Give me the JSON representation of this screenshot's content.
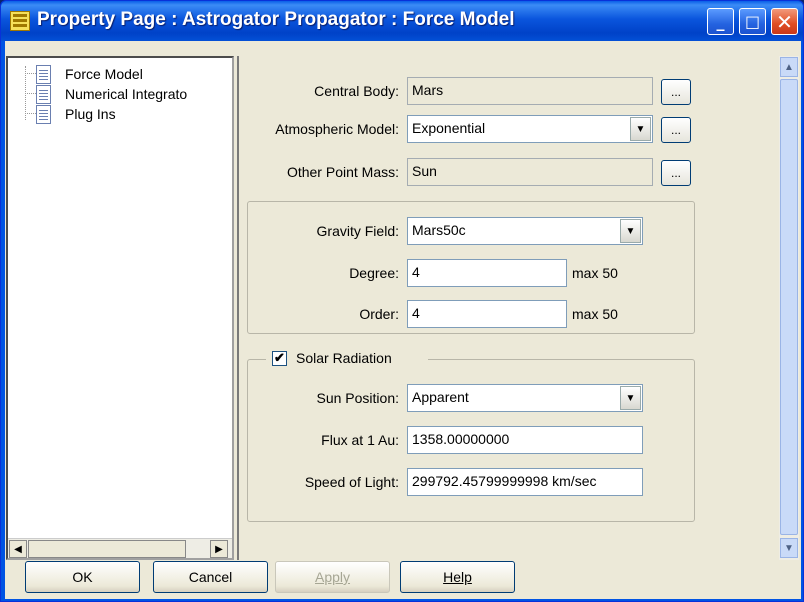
{
  "window": {
    "title": "Property Page : Astrogator Propagator :  Force Model"
  },
  "tree": {
    "items": [
      {
        "label": "Force Model",
        "icon": "document-icon"
      },
      {
        "label": "Numerical Integrato",
        "icon": "document-icon"
      },
      {
        "label": "Plug Ins",
        "icon": "document-icon"
      }
    ]
  },
  "form": {
    "central_body": {
      "label": "Central Body:",
      "value": "Mars",
      "button": "..."
    },
    "atmospheric_model": {
      "label": "Atmospheric Model:",
      "value": "Exponential",
      "button": "..."
    },
    "other_point_mass": {
      "label": "Other Point Mass:",
      "value": "Sun",
      "button": "..."
    },
    "gravity_field": {
      "label": "Gravity Field:",
      "value": "Mars50c"
    },
    "degree": {
      "label": "Degree:",
      "value": "4",
      "max": "max 50"
    },
    "order": {
      "label": "Order:",
      "value": "4",
      "max": "max 50"
    },
    "solar_radiation": {
      "label": "Solar Radiation",
      "checked": true,
      "sun_position": {
        "label": "Sun Position:",
        "value": "Apparent"
      },
      "flux": {
        "label": "Flux at 1 Au:",
        "value": "1358.00000000"
      },
      "speed_of_light": {
        "label": "Speed of Light:",
        "value": "299792.45799999998 km/sec"
      }
    }
  },
  "buttons": {
    "ok": "OK",
    "cancel": "Cancel",
    "apply": "Apply",
    "help": "Help"
  },
  "colors": {
    "titlebar": "#0054e3",
    "client_bg": "#ece9d8"
  }
}
